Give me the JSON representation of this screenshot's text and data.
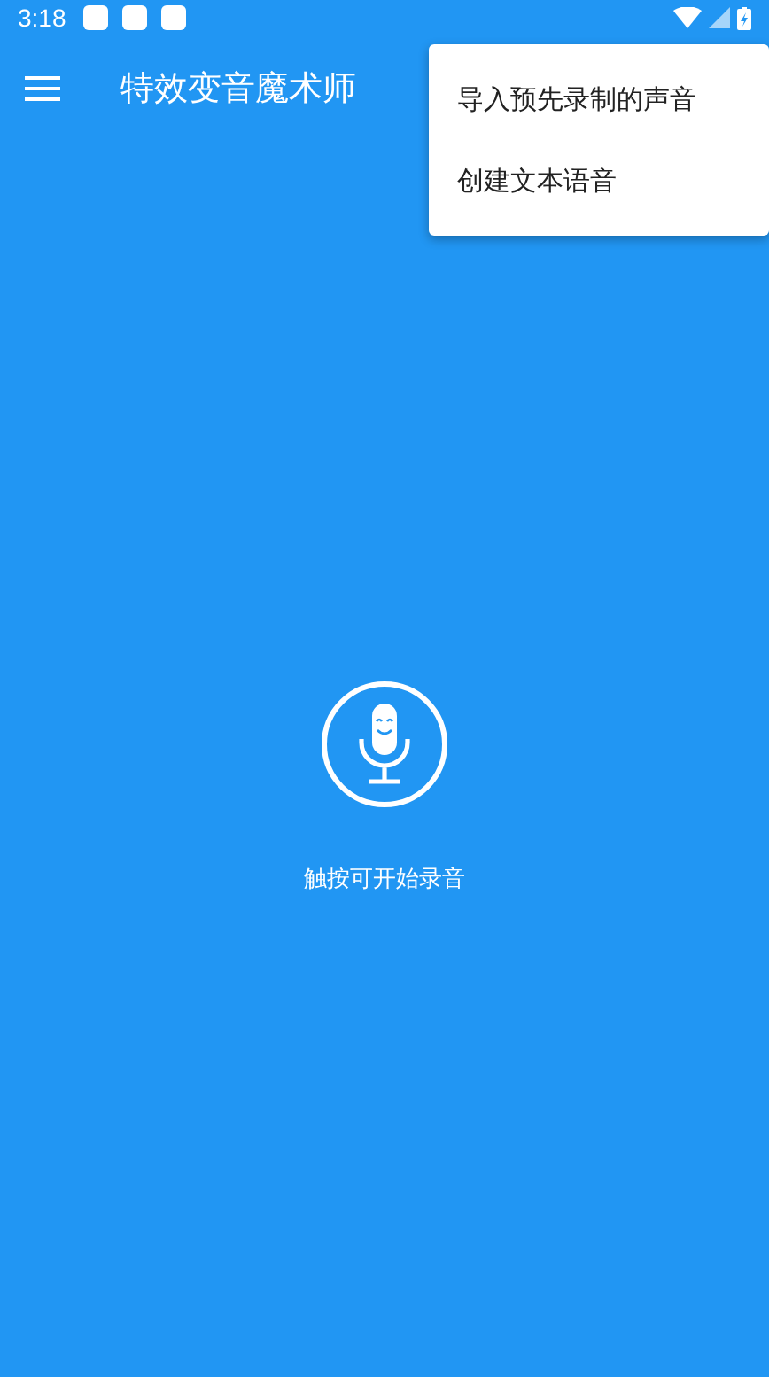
{
  "status_bar": {
    "time": "3:18",
    "notifications": [
      {
        "kind": "app"
      },
      {
        "kind": "app"
      },
      {
        "kind": "app"
      }
    ]
  },
  "app_bar": {
    "title": "特效变音魔术师"
  },
  "record": {
    "hint": "触按可开始录音"
  },
  "menu": {
    "items": [
      {
        "label": "导入预先录制的声音"
      },
      {
        "label": "创建文本语音"
      }
    ]
  }
}
